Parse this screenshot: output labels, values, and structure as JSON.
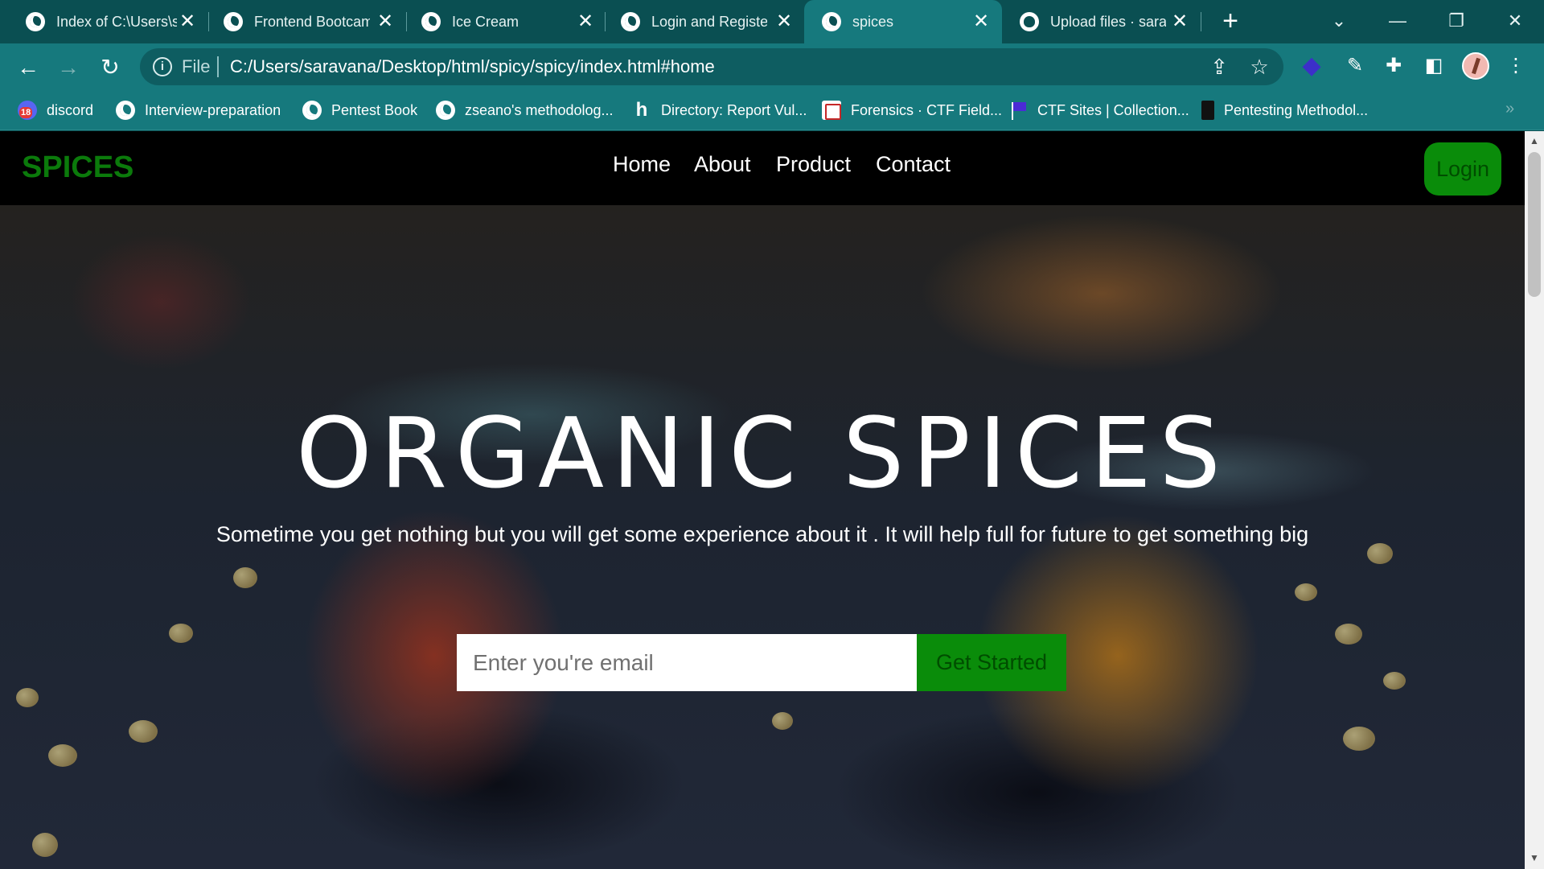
{
  "browser": {
    "tabs": [
      {
        "title": "Index of C:\\Users\\s",
        "icon": "globe-icon"
      },
      {
        "title": "Frontend Bootcam",
        "icon": "globe-icon"
      },
      {
        "title": "Ice Cream",
        "icon": "globe-icon"
      },
      {
        "title": "Login and Register",
        "icon": "globe-icon"
      },
      {
        "title": "spices",
        "icon": "globe-icon",
        "active": true
      },
      {
        "title": "Upload files · sarav",
        "icon": "github-icon"
      }
    ],
    "new_tab": "+",
    "close_glyph": "✕",
    "window": {
      "tab_search": "⌄",
      "minimize": "—",
      "restore": "❐",
      "close": "✕"
    },
    "nav": {
      "back": "←",
      "forward": "→",
      "reload": "↻"
    },
    "omnibox": {
      "info": "i",
      "scheme": "File",
      "url": "C:/Users/saravana/Desktop/html/spicy/spicy/index.html#home"
    },
    "toolbar_icons": {
      "share": "⇪",
      "star": "☆",
      "extensions": "✚",
      "sidepanel": "◧",
      "menu": "⋮",
      "diamond": "◆",
      "pen": "✎"
    },
    "bookmarks": [
      {
        "label": "discord",
        "icon": "discord-icon"
      },
      {
        "label": "Interview-preparation",
        "icon": "globe-icon"
      },
      {
        "label": "Pentest Book",
        "icon": "globe-icon"
      },
      {
        "label": "zseano's methodolog...",
        "icon": "globe-icon"
      },
      {
        "label": "Directory: Report Vul...",
        "icon": "hackerone-icon"
      },
      {
        "label": "Forensics · CTF Field...",
        "icon": "book-icon"
      },
      {
        "label": "CTF Sites | Collection...",
        "icon": "flag-icon"
      },
      {
        "label": "Pentesting Methodol...",
        "icon": "pentest-icon"
      }
    ],
    "bookmarks_more": "»"
  },
  "site": {
    "brand": "SPICES",
    "nav": [
      "Home",
      "About",
      "Product",
      "Contact"
    ],
    "login": "Login",
    "hero": {
      "title": "ORGANIC SPICES",
      "subtitle": "Sometime you get nothing but you will get some experience about it . It will help full for future to get something big",
      "email_placeholder": "Enter you're email",
      "cta": "Get Started"
    }
  },
  "colors": {
    "chrome_dark": "#0a4f52",
    "chrome_light": "#16797d",
    "brand_green": "#0b7a0b",
    "button_green": "#0a8c0a",
    "button_text": "#004d00"
  }
}
